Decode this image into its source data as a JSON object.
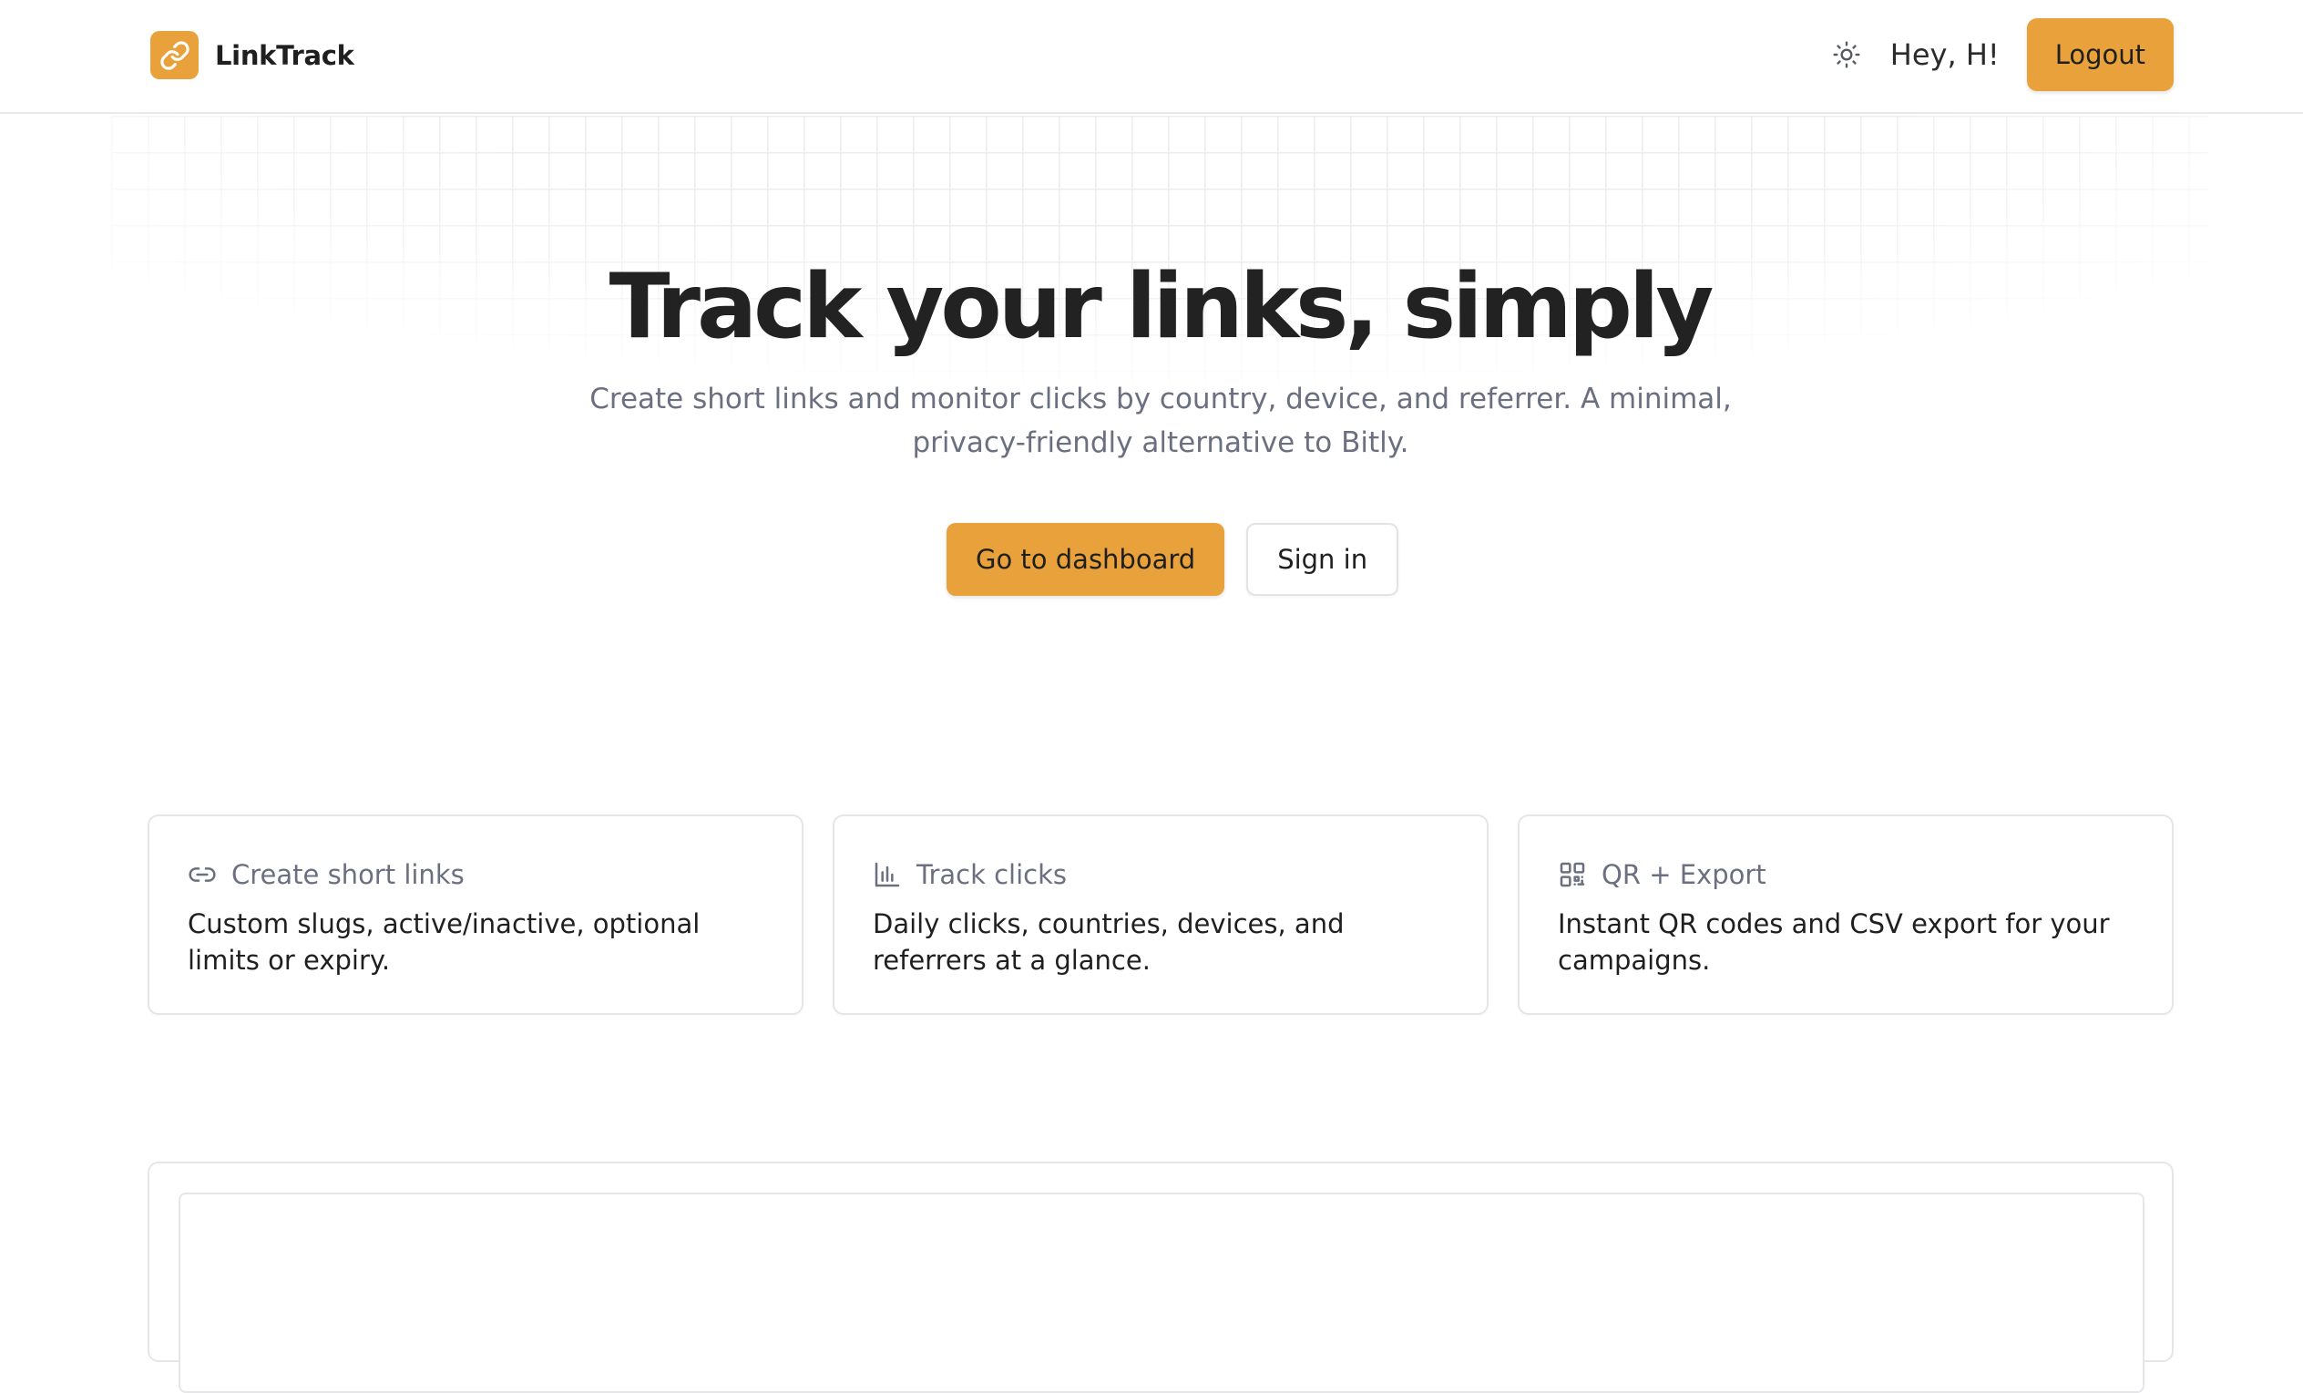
{
  "header": {
    "brand_name": "LinkTrack",
    "logo_icon": "link-icon",
    "theme_icon": "sun-icon",
    "greeting": "Hey, H!",
    "logout_label": "Logout"
  },
  "hero": {
    "title": "Track your links, simply",
    "subtitle": "Create short links and monitor clicks by country, device, and referrer. A minimal, privacy-friendly alternative to Bitly.",
    "primary_cta": "Go to dashboard",
    "secondary_cta": "Sign in"
  },
  "features": [
    {
      "icon": "link-icon",
      "title": "Create short links",
      "description": "Custom slugs, active/inactive, optional limits or expiry."
    },
    {
      "icon": "bar-chart-icon",
      "title": "Track clicks",
      "description": "Daily clicks, countries, devices, and referrers at a glance."
    },
    {
      "icon": "qr-code-icon",
      "title": "QR + Export",
      "description": "Instant QR codes and CSV export for your campaigns."
    }
  ],
  "colors": {
    "accent": "#e9a23b",
    "text": "#1f1f1f",
    "muted": "#6b7080",
    "border": "#e6e6e9"
  }
}
